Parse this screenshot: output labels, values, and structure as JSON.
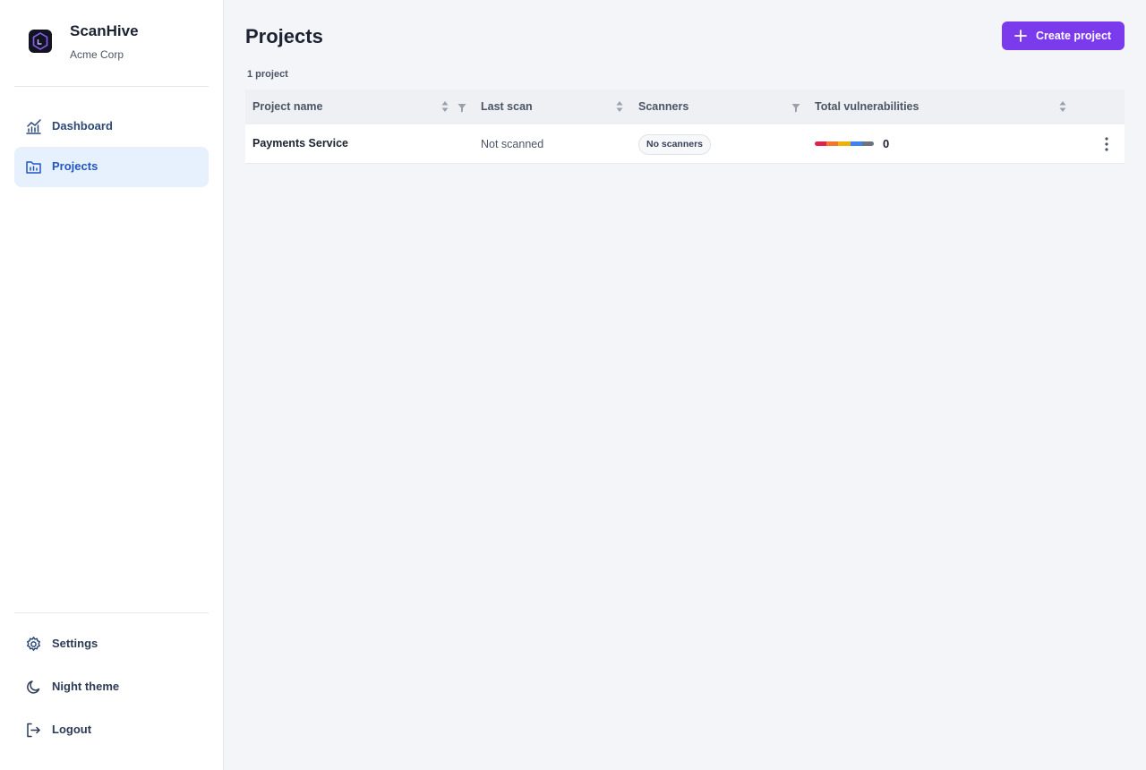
{
  "brand": {
    "name": "ScanHive",
    "org": "Acme Corp",
    "icon": "hexagon-logo-icon"
  },
  "nav": {
    "items": [
      {
        "label": "Dashboard",
        "icon": "chart-line-icon",
        "active": false
      },
      {
        "label": "Projects",
        "icon": "folder-chart-icon",
        "active": true
      }
    ],
    "bottom": [
      {
        "label": "Settings",
        "icon": "gear-icon"
      },
      {
        "label": "Night theme",
        "icon": "moon-icon"
      },
      {
        "label": "Logout",
        "icon": "logout-icon"
      }
    ]
  },
  "page": {
    "title": "Projects",
    "create_label": "Create project",
    "count_label": "1 project"
  },
  "table": {
    "columns": [
      "Project name",
      "Last scan",
      "Scanners",
      "Total vulnerabilities"
    ],
    "rows": [
      {
        "name": "Payments Service",
        "last_scan": "Not scanned",
        "scanners": "No scanners",
        "total": "0"
      }
    ]
  },
  "colors": {
    "accent": "#7c3aed",
    "active_nav_bg": "#e7f0fd",
    "severity": [
      "#e0234e",
      "#f2762e",
      "#eab308",
      "#3b82f6",
      "#6b7280"
    ]
  }
}
